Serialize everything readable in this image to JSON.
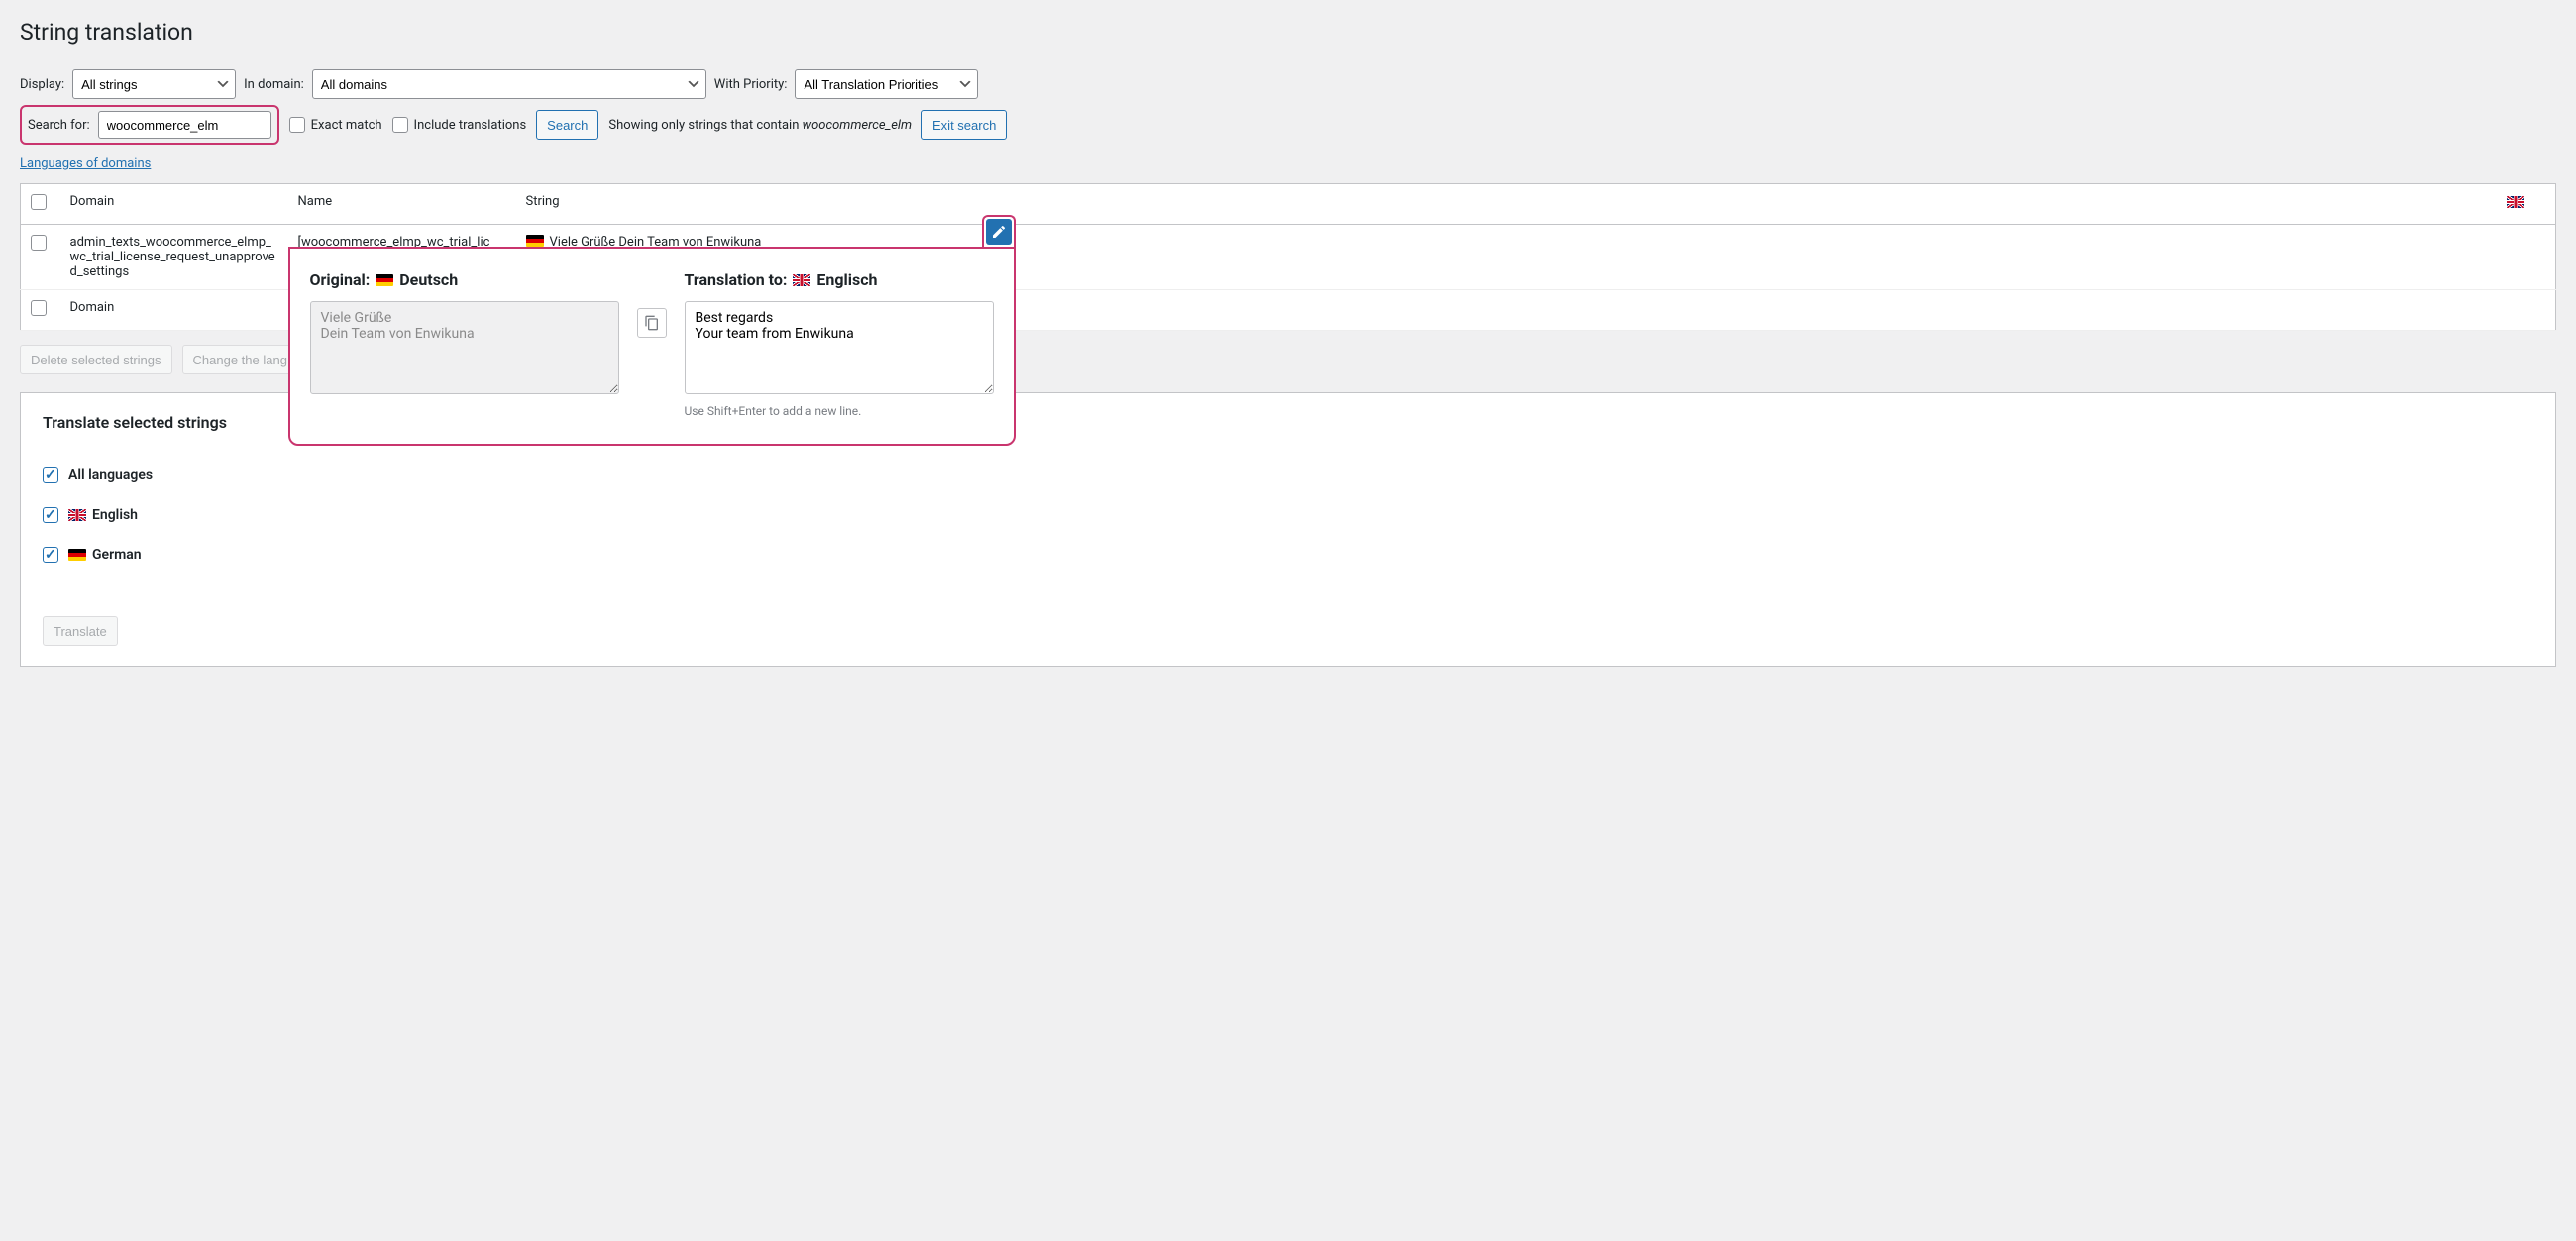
{
  "page_title": "String translation",
  "filter": {
    "display_label": "Display:",
    "display_value": "All strings",
    "in_domain_label": "In domain:",
    "in_domain_value": "All domains",
    "priority_label": "With Priority:",
    "priority_value": "All Translation Priorities"
  },
  "search": {
    "label": "Search for:",
    "value": "woocommerce_elm",
    "exact_match_label": "Exact match",
    "include_translations_label": "Include translations",
    "search_button": "Search",
    "result_prefix": "Showing only strings that contain ",
    "result_term": "woocommerce_elm",
    "exit_button": "Exit search"
  },
  "languages_link": "Languages of domains",
  "table": {
    "headers": {
      "domain": "Domain",
      "name": "Name",
      "string": "String"
    },
    "row": {
      "domain": "admin_texts_woocommerce_elmp_wc_trial_license_request_unapproved_settings",
      "name": "[woocommerce_elmp_wc_trial_lic",
      "string": "Viele Grüße Dein Team von Enwikuna"
    },
    "footer_domain": "Domain"
  },
  "actions": {
    "delete": "Delete selected strings",
    "change": "Change the lang..."
  },
  "editor": {
    "original_label": "Original:",
    "original_lang": "Deutsch",
    "original_text": "Viele Grüße\nDein Team von Enwikuna",
    "translation_label": "Translation to:",
    "translation_lang": "Englisch",
    "translation_text": "Best regards\nYour team from Enwikuna",
    "hint": "Use Shift+Enter to add a new line."
  },
  "translate_box": {
    "title": "Translate selected strings",
    "all_languages": "All languages",
    "english": "English",
    "german": "German",
    "translate_button": "Translate"
  },
  "colors": {
    "highlight": "#c9356e",
    "primary": "#2271b1"
  }
}
